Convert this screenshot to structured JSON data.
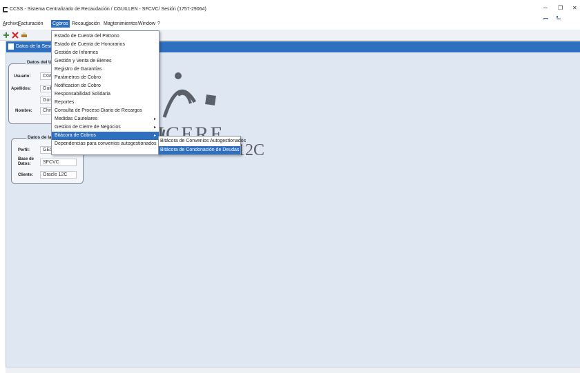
{
  "window": {
    "title": "CCSS - Sistema Centralizado de Recaudación / CGUILLEN - SFCVC/ Sesión (1757-29064)",
    "minimize": "–",
    "restore": "❐",
    "close": "✕",
    "brand_logo": "S",
    "brand_sub": "ICERE"
  },
  "menubar": {
    "items": [
      "Archivo",
      "Facturación",
      "Cobros",
      "Recaudación",
      "Mantenimientos",
      "Window",
      "?"
    ],
    "active": "Cobros"
  },
  "toolbar": {
    "icons": [
      "new-record-icon",
      "delete-icon",
      "print-icon"
    ]
  },
  "panel": {
    "title": "Datos de la Sesi"
  },
  "user_group": {
    "title": "Datos del U",
    "usuario_label": "Usuario:",
    "usuario_value": "CGU",
    "apellidos_label": "Apellidos:",
    "apellido1_value": "Guill",
    "apellido2_value": "Gom",
    "nombre_label": "Nombre:",
    "nombre_value": "Chris"
  },
  "session_group": {
    "title": "Datos de la",
    "perfil_label": "Perfil:",
    "perfil_value": "GEST",
    "base_label_1": "Base de",
    "base_label_2": "Datos:",
    "base_value": "SFCVC",
    "cliente_label": "Cliente:",
    "cliente_value": "Oracle 12C"
  },
  "background": {
    "logo_text": "ICERE",
    "version_text": "12C"
  },
  "dropdown": {
    "items": [
      "Estado de Cuenta del Patrono",
      "Estado de Cuenta de Honorarios",
      "Gestión de Informes",
      "Gestión y Venta de Bienes",
      "Registro de Garantías",
      "Parámetros de Cobro",
      "Notificacion de Cobro",
      "Responsabilidad Solidaria",
      "Reportes",
      "Consulta de Proceso Diario de Recargos",
      "Medidas Cautelares",
      "Gestion de Cierre de Negocios",
      "Bitácora de Cobros",
      "Dependencias para convenios autogestionados"
    ],
    "submenu_items": [
      "Bitácora de Convenios Autogestionados",
      "Bitácora de Condonación de Deudas"
    ]
  },
  "colors": {
    "accent": "#2f6fbf",
    "workspace": "#dfe7f3"
  }
}
